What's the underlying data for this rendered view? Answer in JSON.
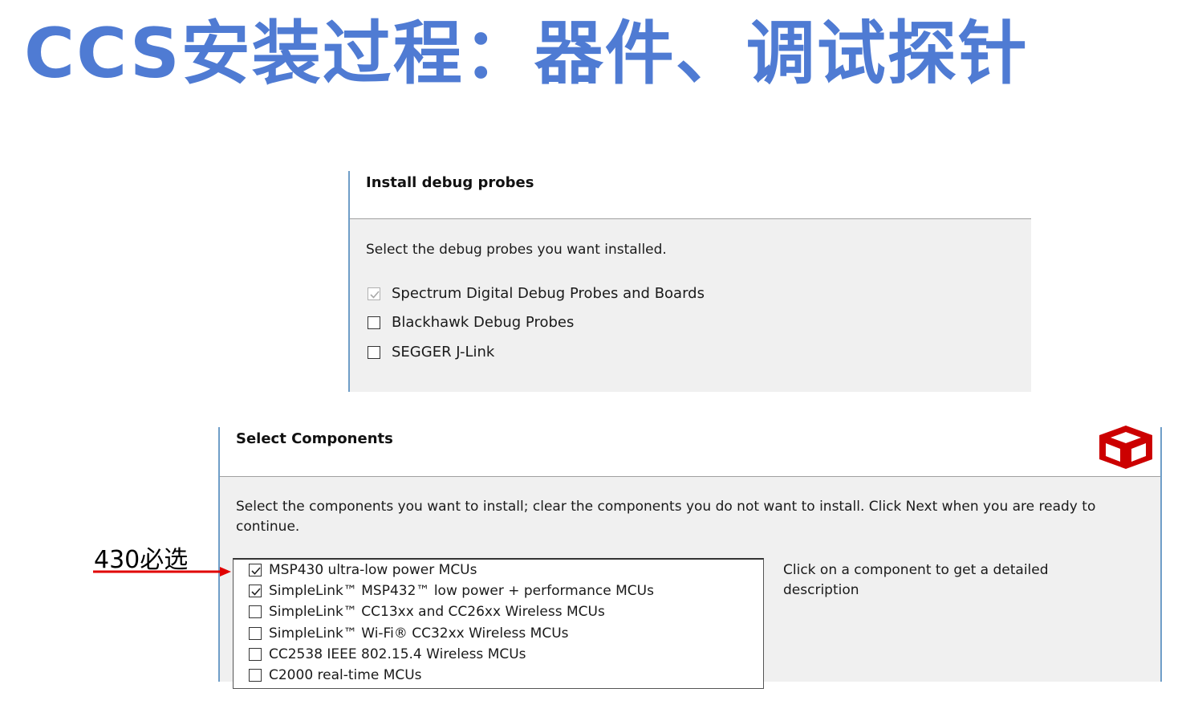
{
  "slide": {
    "title": "CCS安装过程：器件、调试探针"
  },
  "probes_dialog": {
    "title": "Install debug probes",
    "instruction": "Select the debug probes you want installed.",
    "options": [
      {
        "label": "Spectrum Digital Debug Probes and Boards",
        "checked": true,
        "disabled": true
      },
      {
        "label": "Blackhawk Debug Probes",
        "checked": false,
        "disabled": false
      },
      {
        "label": "SEGGER J-Link",
        "checked": false,
        "disabled": false
      }
    ]
  },
  "components_dialog": {
    "title": "Select Components",
    "instruction": "Select the components you want to install; clear the components you do not want to install. Click Next when you are ready to continue.",
    "components": [
      {
        "label": "MSP430 ultra-low power MCUs",
        "checked": true
      },
      {
        "label": "SimpleLink™ MSP432™ low power + performance MCUs",
        "checked": true
      },
      {
        "label": "SimpleLink™ CC13xx and CC26xx Wireless MCUs",
        "checked": false
      },
      {
        "label": "SimpleLink™ Wi-Fi® CC32xx Wireless MCUs",
        "checked": false
      },
      {
        "label": "CC2538 IEEE 802.15.4 Wireless MCUs",
        "checked": false
      },
      {
        "label": "C2000 real-time MCUs",
        "checked": false
      }
    ],
    "description_hint": "Click on a component to get a detailed description",
    "logo_icon": "ti-logo-icon",
    "logo_color": "#cc0000"
  },
  "annotation": {
    "label": "430必选",
    "arrow_color": "#e00000"
  },
  "colors": {
    "title": "#4f7bd3",
    "panel_bg": "#f0f0f0",
    "panel_accent": "#6f9ec8"
  }
}
